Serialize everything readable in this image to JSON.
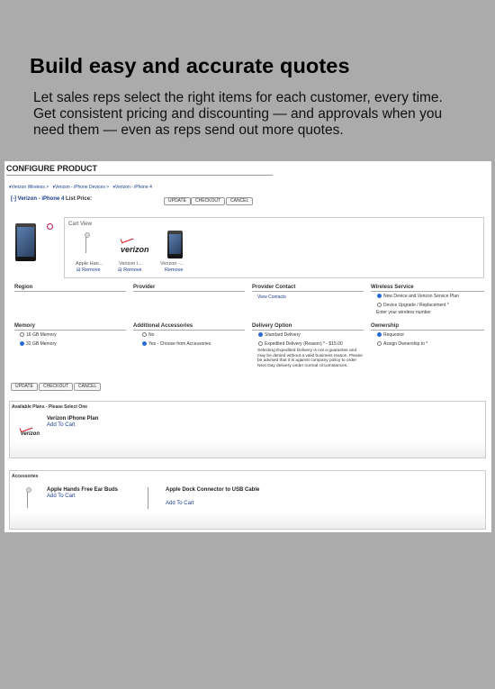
{
  "marketing": {
    "headline": "Build easy and accurate quotes",
    "subtext": "Let sales reps select the right items for each customer, every time. Get consistent pricing and discounting — and approvals when you need them — even as reps send out more quotes."
  },
  "app": {
    "title": "CONFIGURE PRODUCT",
    "breadcrumbs": [
      "▾Verizon Wireless >",
      "▾Verizon - iPhone Devices >",
      "▾Verizon - iPhone 4"
    ],
    "product_toggle": "[-]",
    "product_name": "Verizon - iPhone 4",
    "list_price_label": "List Price:",
    "buttons": {
      "update": "UPDATE",
      "checkout": "CHECKOUT",
      "cancel": "CANCEL"
    },
    "cart": {
      "label": "Cart View",
      "items": [
        {
          "name": "Apple Han...",
          "remove": "⊟ Remove"
        },
        {
          "name": "Verizon i...",
          "remove": "⊟ Remove"
        },
        {
          "name": "Verizon -...",
          "remove": "Remove"
        }
      ]
    },
    "sections": {
      "region": "Region",
      "provider": "Provider",
      "provider_contact": {
        "label": "Provider Contact",
        "link": "View Contacts"
      },
      "wireless_service": {
        "label": "Wireless Service",
        "options": [
          "New Device and Verizon Service Plan",
          "Device Upgrade / Replacement *"
        ],
        "selected": 0,
        "hint": "Enter your wireless number"
      },
      "memory": {
        "label": "Memory",
        "options": [
          "16 GB Memory",
          "32 GB Memory"
        ],
        "selected": 1
      },
      "additional_accessories": {
        "label": "Additional Accessories",
        "options": [
          "No",
          "Yes - Choose from Accessories"
        ],
        "selected": 1
      },
      "delivery_option": {
        "label": "Delivery Option",
        "options": [
          "Standard Delivery",
          "Expedited Delivery (Reason) * - $15.00"
        ],
        "selected": 0,
        "note": "Selecting Expedited Delivery is not a guarantee and may be denied without a valid business reason. Please be advised that it is against company policy to order Next Day delivery under normal circumstances."
      },
      "ownership": {
        "label": "Ownership",
        "options": [
          "Requestor",
          "Assign Ownership to *"
        ],
        "selected": 0
      }
    },
    "plans": {
      "title": "Available Plans - Please Select One",
      "items": [
        {
          "name": "Verizon iPhone Plan",
          "action": "Add To Cart",
          "logo": "verizon"
        }
      ]
    },
    "accessories": {
      "title": "Accessories",
      "items": [
        {
          "name": "Apple Hands Free Ear Buds",
          "action": "Add To Cart"
        },
        {
          "name": "Apple Dock Connector to USB Cable",
          "action": "Add To Cart"
        }
      ]
    }
  }
}
